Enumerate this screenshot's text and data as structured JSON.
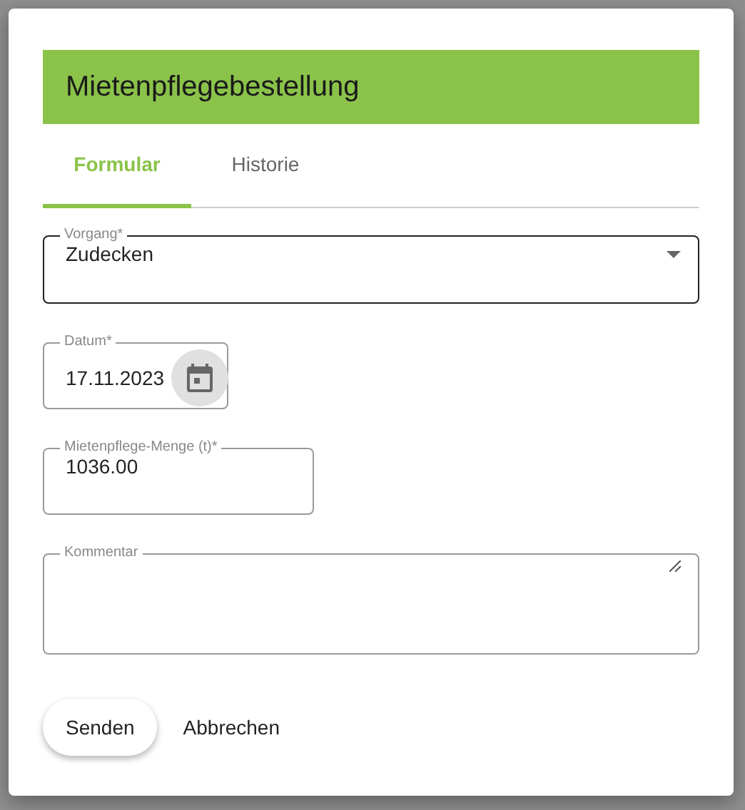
{
  "dialog": {
    "title": "Mietenpflegebestellung"
  },
  "tabs": [
    {
      "label": "Formular",
      "selected": true
    },
    {
      "label": "Historie",
      "selected": false
    }
  ],
  "fields": [
    {
      "kind": "select",
      "label": "Vorgang*",
      "value": "Zudecken",
      "focused": true
    },
    {
      "kind": "date",
      "label": "Datum*",
      "value": "17.11.2023",
      "focused": false
    },
    {
      "kind": "number",
      "label": "Mietenpflege-Menge (t)*",
      "value": "1036.00",
      "focused": false
    },
    {
      "kind": "textarea",
      "label": "Kommentar",
      "focused": false
    }
  ],
  "buttons": [
    {
      "label": "Senden",
      "kind": "raised"
    },
    {
      "label": "Abbrechen",
      "kind": "flat"
    }
  ]
}
